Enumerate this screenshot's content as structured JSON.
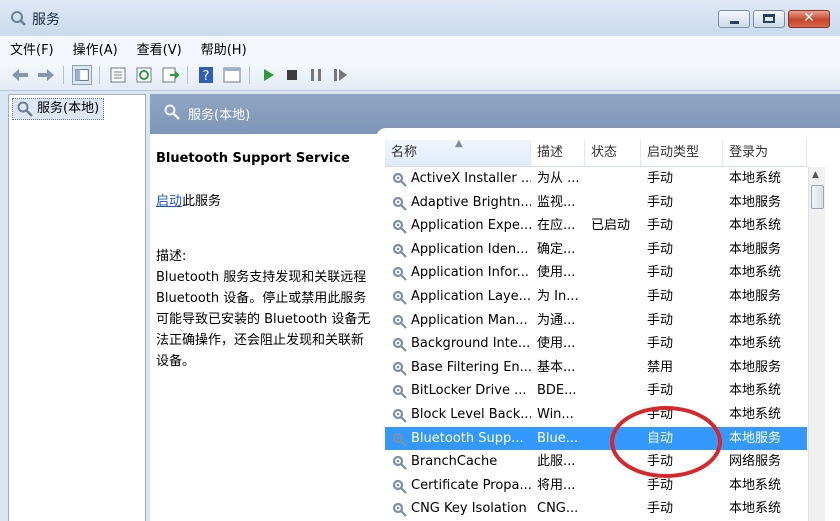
{
  "window": {
    "title": "服务",
    "icon": "services-gear-icon"
  },
  "menubar": [
    "文件(F)",
    "操作(A)",
    "查看(V)",
    "帮助(H)"
  ],
  "toolbar": [
    "back-arrow-icon",
    "forward-arrow-icon",
    "show-tree-icon",
    "properties-icon",
    "refresh-icon",
    "export-icon",
    "help-icon",
    "console-icon",
    "start-play-icon",
    "stop-icon",
    "pause-icon",
    "restart-icon"
  ],
  "tree": {
    "root_label": "服务(本地)"
  },
  "pane_header": {
    "label": "服务(本地)"
  },
  "details": {
    "service_title": "Bluetooth Support Service",
    "start_link": "启动",
    "start_suffix": "此服务",
    "desc_label": "描述:",
    "desc_lines": [
      "Bluetooth 服务支持发现和关联远程",
      "Bluetooth 设备。停止或禁用此服务",
      "可能导致已安装的 Bluetooth 设备无",
      "法正确操作，还会阻止发现和关联新",
      "设备。"
    ]
  },
  "columns": {
    "name": "名称",
    "desc": "描述",
    "status": "状态",
    "startup": "启动类型",
    "logon": "登录为"
  },
  "services": [
    {
      "name": "ActiveX Installer ...",
      "desc": "为从 ...",
      "status": "",
      "startup": "手动",
      "logon": "本地系统"
    },
    {
      "name": "Adaptive Brightn...",
      "desc": "监视...",
      "status": "",
      "startup": "手动",
      "logon": "本地服务"
    },
    {
      "name": "Application Expe...",
      "desc": "在应...",
      "status": "已启动",
      "startup": "手动",
      "logon": "本地系统"
    },
    {
      "name": "Application Iden...",
      "desc": "确定...",
      "status": "",
      "startup": "手动",
      "logon": "本地服务"
    },
    {
      "name": "Application Infor...",
      "desc": "使用...",
      "status": "",
      "startup": "手动",
      "logon": "本地系统"
    },
    {
      "name": "Application Laye...",
      "desc": "为 In...",
      "status": "",
      "startup": "手动",
      "logon": "本地服务"
    },
    {
      "name": "Application Man...",
      "desc": "为通...",
      "status": "",
      "startup": "手动",
      "logon": "本地系统"
    },
    {
      "name": "Background Inte...",
      "desc": "使用...",
      "status": "",
      "startup": "手动",
      "logon": "本地系统"
    },
    {
      "name": "Base Filtering En...",
      "desc": "基本...",
      "status": "",
      "startup": "禁用",
      "logon": "本地服务"
    },
    {
      "name": "BitLocker Drive ...",
      "desc": "BDE...",
      "status": "",
      "startup": "手动",
      "logon": "本地系统"
    },
    {
      "name": "Block Level Back...",
      "desc": "Win...",
      "status": "",
      "startup": "手动",
      "logon": "本地系统"
    },
    {
      "name": "Bluetooth Supp...",
      "desc": "Blue...",
      "status": "",
      "startup": "自动",
      "logon": "本地服务",
      "selected": true
    },
    {
      "name": "BranchCache",
      "desc": "此服...",
      "status": "",
      "startup": "手动",
      "logon": "网络服务"
    },
    {
      "name": "Certificate Propa...",
      "desc": "将用...",
      "status": "",
      "startup": "手动",
      "logon": "本地系统"
    },
    {
      "name": "CNG Key Isolation",
      "desc": "CNG...",
      "status": "",
      "startup": "手动",
      "logon": "本地系统"
    }
  ],
  "colors": {
    "selection": "#3399ff",
    "link": "#1a55c8",
    "annotation_circle": "#d9262b",
    "pane_header": "#8aa0c0"
  }
}
